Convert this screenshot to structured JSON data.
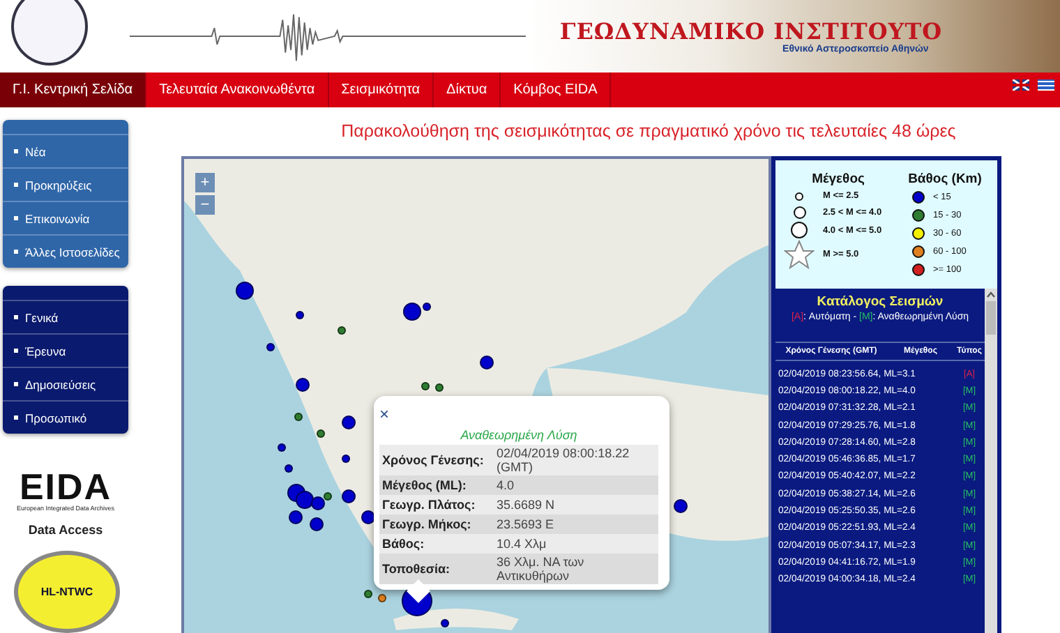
{
  "header": {
    "title": "ΓΕΩΔΥΝΑΜΙΚΟ ΙΝΣΤΙΤΟΥΤΟ",
    "subtitle": "Εθνικό Αστεροσκοπείο Αθηνών"
  },
  "nav": [
    {
      "label": "Γ.Ι. Κεντρική Σελίδα",
      "selected": true
    },
    {
      "label": "Τελευταία Ανακοινωθέντα",
      "selected": false
    },
    {
      "label": "Σεισμικότητα",
      "selected": false
    },
    {
      "label": "Δίκτυα",
      "selected": false
    },
    {
      "label": "Κόμβος EIDA",
      "selected": false
    }
  ],
  "sidebar": {
    "menus": [
      {
        "kind": "light",
        "items": [
          "Νέα",
          "Προκηρύξεις",
          "Επικοινωνία",
          "Άλλες Ιστοσελίδες"
        ]
      },
      {
        "kind": "dark",
        "items": [
          "Γενικά",
          "Έρευνα",
          "Δημοσιεύσεις",
          "Προσωπικό"
        ]
      }
    ],
    "eida": {
      "logo": "EIDA",
      "tagline": "European Integrated Data Archives"
    },
    "data_access": "Data Access",
    "tsunami_logo": "HL-NTWC"
  },
  "page_title": "Παρακολούθηση της σεισμικότητας σε πραγματικό χρόνο τις τελευταίες 48 ώρες",
  "map": {
    "zoom_in": "+",
    "zoom_out": "−",
    "markers": [
      {
        "kind": "large",
        "color": "#0000cc"
      },
      {
        "kind": "small",
        "color": "#0000cc"
      },
      {
        "kind": "large",
        "color": "#0000cc"
      },
      {
        "kind": "small",
        "color": "#0000cc"
      },
      {
        "kind": "small",
        "color": "#2e7d32"
      },
      {
        "kind": "small",
        "color": "#0000cc"
      },
      {
        "kind": "medium",
        "color": "#0000cc"
      },
      {
        "kind": "medium",
        "color": "#0000cc"
      },
      {
        "kind": "small",
        "color": "#2e7d32"
      },
      {
        "kind": "small",
        "color": "#2e7d32"
      },
      {
        "kind": "small",
        "color": "#2e7d32"
      },
      {
        "kind": "small",
        "color": "#2e7d32"
      },
      {
        "kind": "medium",
        "color": "#0000cc"
      },
      {
        "kind": "small",
        "color": "#0000cc"
      },
      {
        "kind": "small",
        "color": "#0000cc"
      },
      {
        "kind": "small",
        "color": "#0000cc"
      },
      {
        "kind": "large",
        "color": "#0000cc"
      },
      {
        "kind": "large",
        "color": "#0000cc"
      },
      {
        "kind": "medium",
        "color": "#0000cc"
      },
      {
        "kind": "small",
        "color": "#2e7d32"
      },
      {
        "kind": "medium",
        "color": "#0000cc"
      },
      {
        "kind": "medium",
        "color": "#0000cc"
      },
      {
        "kind": "medium",
        "color": "#0000cc"
      },
      {
        "kind": "medium",
        "color": "#0000cc"
      },
      {
        "kind": "small",
        "color": "#2e7d32"
      },
      {
        "kind": "small",
        "color": "#e08020"
      },
      {
        "kind": "huge",
        "color": "#0000cc"
      },
      {
        "kind": "medium",
        "color": "#0000cc"
      },
      {
        "kind": "small",
        "color": "#0000cc"
      }
    ],
    "popup": {
      "close": "×",
      "heading": "Αναθεωρημένη Λύση",
      "rows": [
        {
          "label": "Χρόνος Γένεσης:",
          "value": "02/04/2019 08:00:18.22 (GMT)"
        },
        {
          "label": "Μέγεθος (ML):",
          "value": "4.0"
        },
        {
          "label": "Γεωγρ. Πλάτος:",
          "value": "35.6689 N"
        },
        {
          "label": "Γεωγρ. Μήκος:",
          "value": "23.5693 E"
        },
        {
          "label": "Βάθος:",
          "value": "10.4 Χλμ"
        },
        {
          "label": "Τοποθεσία:",
          "value": "36 Χλμ. ΝΑ των Αντικυθήρων"
        }
      ]
    }
  },
  "legend": {
    "magnitude_title": "Μέγεθος",
    "magnitudes": [
      {
        "kind": "small",
        "label": "M <= 2.5"
      },
      {
        "kind": "medium",
        "label": "2.5 < M <= 4.0"
      },
      {
        "kind": "large",
        "label": "4.0 < M <= 5.0"
      },
      {
        "kind": "star",
        "label": "M >= 5.0"
      }
    ],
    "depth_title": "Βάθος (Km)",
    "depths": [
      {
        "label": "< 15",
        "color": "#0000cc"
      },
      {
        "label": "15 - 30",
        "color": "#2e7d32"
      },
      {
        "label": "30 - 60",
        "color": "#f5f000"
      },
      {
        "label": "60 - 100",
        "color": "#e08020"
      },
      {
        "label": ">= 100",
        "color": "#d02020"
      }
    ]
  },
  "catalogue": {
    "title": "Κατάλογος Σεισμών",
    "note": {
      "auto_tag": "[A]",
      "auto_label": ": Αυτόματη -",
      "revised_tag": "[M]",
      "revised_label": ": Αναθεωρημένη Λύση"
    },
    "columns": [
      "Χρόνος Γένεσης (GMT)",
      "Μέγεθος",
      "Τύπος"
    ],
    "rows": [
      {
        "event": "02/04/2019 08:23:56.64, ML=3.1",
        "type": "[A]",
        "kind": "auto"
      },
      {
        "event": "02/04/2019 08:00:18.22, ML=4.0",
        "type": "[M]",
        "kind": "revised"
      },
      {
        "event": "02/04/2019 07:31:32.28, ML=2.1",
        "type": "[M]",
        "kind": "revised"
      },
      {
        "event": "02/04/2019 07:29:25.76, ML=1.8",
        "type": "[M]",
        "kind": "revised"
      },
      {
        "event": "02/04/2019 07:28:14.60, ML=2.8",
        "type": "[M]",
        "kind": "revised"
      },
      {
        "event": "02/04/2019 05:46:36.85, ML=1.7",
        "type": "[M]",
        "kind": "revised"
      },
      {
        "event": "02/04/2019 05:40:42.07, ML=2.2",
        "type": "[M]",
        "kind": "revised"
      },
      {
        "event": "02/04/2019 05:38:27.14, ML=2.6",
        "type": "[M]",
        "kind": "revised"
      },
      {
        "event": "02/04/2019 05:25:50.35, ML=2.6",
        "type": "[M]",
        "kind": "revised"
      },
      {
        "event": "02/04/2019 05:22:51.93, ML=2.4",
        "type": "[M]",
        "kind": "revised"
      },
      {
        "event": "02/04/2019 05:07:34.17, ML=2.3",
        "type": "[M]",
        "kind": "revised"
      },
      {
        "event": "02/04/2019 04:41:16.72, ML=1.9",
        "type": "[M]",
        "kind": "revised"
      },
      {
        "event": "02/04/2019 04:00:34.18, ML=2.4",
        "type": "[M]",
        "kind": "revised"
      }
    ]
  }
}
